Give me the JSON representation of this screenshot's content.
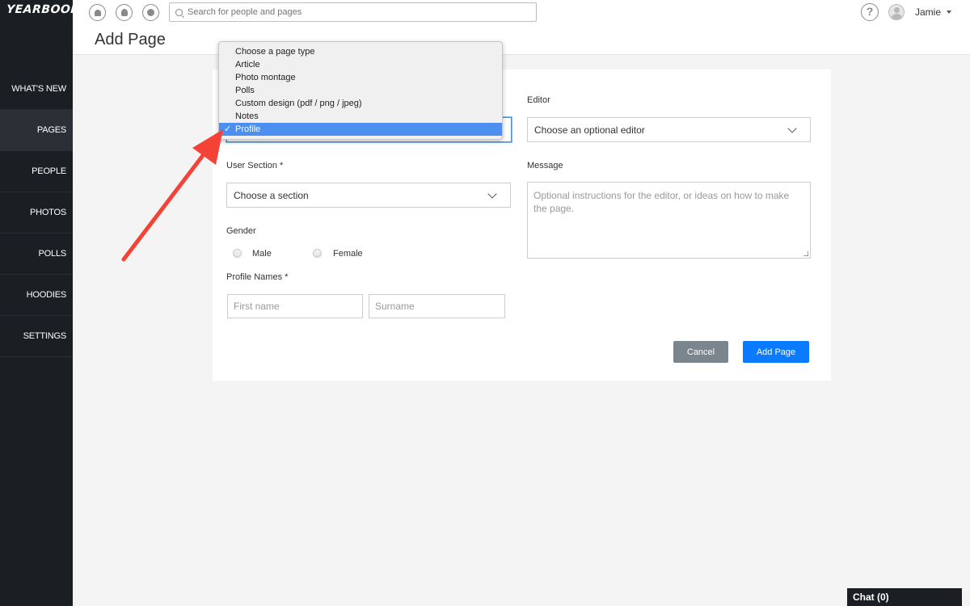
{
  "app": {
    "logo": "YEARBOOK"
  },
  "sidebar": {
    "items": [
      {
        "label": "WHAT'S NEW",
        "active": false
      },
      {
        "label": "PAGES",
        "active": true
      },
      {
        "label": "PEOPLE",
        "active": false
      },
      {
        "label": "PHOTOS",
        "active": false
      },
      {
        "label": "POLLS",
        "active": false
      },
      {
        "label": "HOODIES",
        "active": false
      },
      {
        "label": "SETTINGS",
        "active": false
      }
    ]
  },
  "topbar": {
    "icons": [
      "notifications-icon",
      "profile-icon",
      "messages-icon"
    ],
    "search": {
      "placeholder": "Search for people and pages",
      "value": ""
    },
    "help_icon": "?",
    "user": {
      "name": "Jamie"
    }
  },
  "header": {
    "title": "Add Page"
  },
  "form": {
    "page_type": {
      "options": [
        "Choose a page type",
        "Article",
        "Photo montage",
        "Polls",
        "Custom design (pdf / png / jpeg)",
        "Notes",
        "Profile"
      ],
      "selected": "Profile",
      "check_mark": "✓"
    },
    "editor": {
      "label": "Editor",
      "value": "Choose an optional editor"
    },
    "user_section": {
      "label": "User Section *",
      "value": "Choose a section"
    },
    "message": {
      "label": "Message",
      "placeholder": "Optional instructions for the editor, or ideas on how to make the page."
    },
    "gender": {
      "label": "Gender",
      "options": [
        "Male",
        "Female"
      ]
    },
    "profile_names": {
      "label": "Profile Names *",
      "first_placeholder": "First name",
      "surname_placeholder": "Surname"
    },
    "buttons": {
      "cancel": "Cancel",
      "add": "Add Page"
    }
  },
  "chat": {
    "label": "Chat (0)"
  },
  "colors": {
    "sidebar_bg": "#1b1e23",
    "primary": "#0a7bff",
    "cancel": "#7a858e",
    "highlight": "#4c8ff0",
    "annotation_arrow": "#f44336"
  }
}
